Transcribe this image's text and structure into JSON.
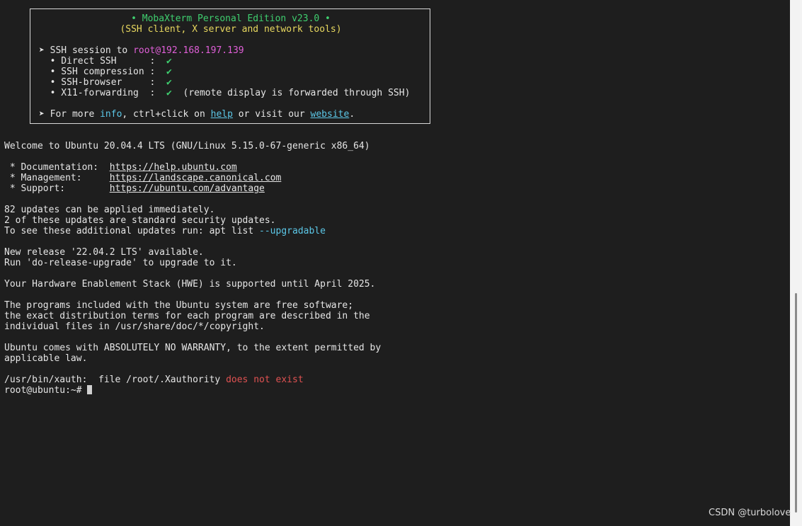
{
  "banner": {
    "title": "• MobaXterm Personal Edition v23.0 •",
    "subtitle": "(SSH client, X server and network tools)",
    "session_prefix": "➤ SSH session to ",
    "session_target": "root@192.168.197.139",
    "features": [
      {
        "label": "  • Direct SSH      :  ",
        "check": "✔",
        "note": ""
      },
      {
        "label": "  • SSH compression :  ",
        "check": "✔",
        "note": ""
      },
      {
        "label": "  • SSH-browser     :  ",
        "check": "✔",
        "note": ""
      },
      {
        "label": "  • X11-forwarding  :  ",
        "check": "✔",
        "note": "  (remote display is forwarded through SSH)"
      }
    ],
    "more_prefix": "➤ For more ",
    "info": "info",
    "more_mid": ", ctrl+click on ",
    "help": "help",
    "visit": " or visit our ",
    "website": "website",
    "period": "."
  },
  "terminal": {
    "welcome": "Welcome to Ubuntu 20.04.4 LTS (GNU/Linux 5.15.0-67-generic x86_64)",
    "doc_label": " * Documentation:  ",
    "doc_url": "https://help.ubuntu.com",
    "mgmt_label": " * Management:     ",
    "mgmt_url": "https://landscape.canonical.com",
    "support_label": " * Support:        ",
    "support_url": "https://ubuntu.com/advantage",
    "updates_1": "82 updates can be applied immediately.",
    "updates_2": "2 of these updates are standard security updates.",
    "updates_3_prefix": "To see these additional updates run: apt list ",
    "updates_3_flag": "--upgradable",
    "release_1": "New release '22.04.2 LTS' available.",
    "release_2": "Run 'do-release-upgrade' to upgrade to it.",
    "hwe": "Your Hardware Enablement Stack (HWE) is supported until April 2025.",
    "free_1": "The programs included with the Ubuntu system are free software;",
    "free_2": "the exact distribution terms for each program are described in the",
    "free_3": "individual files in /usr/share/doc/*/copyright.",
    "warranty_1": "Ubuntu comes with ABSOLUTELY NO WARRANTY, to the extent permitted by",
    "warranty_2": "applicable law.",
    "xauth_prefix": "/usr/bin/xauth:  file /root/.Xauthority ",
    "xauth_error": "does not exist",
    "prompt": "root@ubuntu:~# "
  },
  "watermark": "CSDN @turbolove",
  "colors": {
    "background": "#1e1e1e",
    "text": "#e6e6e6",
    "green": "#3fcf6f",
    "yellow": "#e8d85f",
    "magenta": "#e05fd8",
    "cyan": "#5cc8e8",
    "red": "#e05252"
  }
}
